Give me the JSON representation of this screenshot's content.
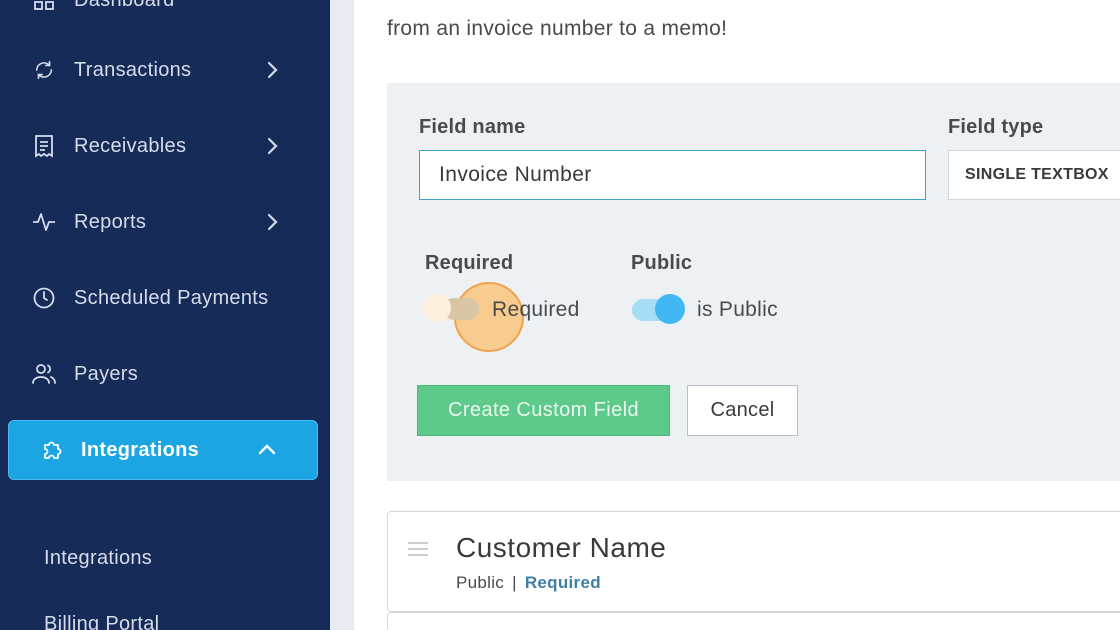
{
  "sidebar": {
    "items": [
      {
        "label": "Dashboard",
        "icon": "dashboard-icon"
      },
      {
        "label": "Transactions",
        "icon": "refresh-icon",
        "has_submenu": true
      },
      {
        "label": "Receivables",
        "icon": "receipt-icon",
        "has_submenu": true
      },
      {
        "label": "Reports",
        "icon": "activity-icon",
        "has_submenu": true
      },
      {
        "label": "Scheduled Payments",
        "icon": "clock-icon"
      },
      {
        "label": "Payers",
        "icon": "users-icon"
      },
      {
        "label": "Integrations",
        "icon": "puzzle-icon",
        "active": true,
        "expanded": true
      }
    ],
    "subitems": [
      {
        "label": "Integrations"
      },
      {
        "label": "Billing Portal"
      }
    ]
  },
  "main": {
    "intro_line1": "from an invoice number to a memo!",
    "form": {
      "field_name_label": "Field name",
      "field_name_value": "Invoice Number",
      "field_type_label": "Field type",
      "field_type_value": "SINGLE TEXTBOX",
      "required_label": "Required",
      "required_toggle_text": "Required",
      "required_on": false,
      "public_label": "Public",
      "public_toggle_text": "is Public",
      "public_on": true,
      "create_button": "Create Custom Field",
      "cancel_button": "Cancel"
    },
    "fields": [
      {
        "name": "Customer Name",
        "visibility": "Public",
        "separator": "|",
        "required": "Required"
      }
    ]
  },
  "colors": {
    "sidebar_bg": "#172b59",
    "active_nav": "#1ba6e3",
    "primary_button": "#5dc98a",
    "toggle_on": "#42b8f2",
    "highlight": "#fbbe6e",
    "required_text": "#3f7fa6"
  }
}
